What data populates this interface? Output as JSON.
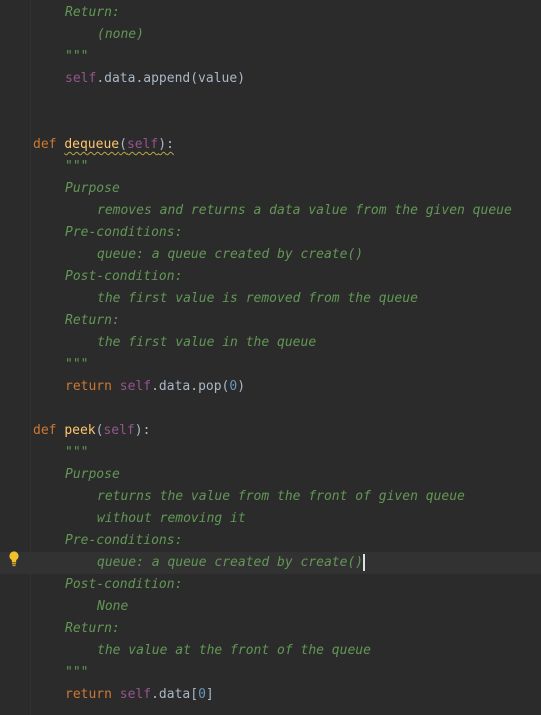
{
  "editor": {
    "lines": [
      {
        "indent": 8,
        "tokens": [
          {
            "t": "doc",
            "v": "Return:"
          }
        ]
      },
      {
        "indent": 12,
        "tokens": [
          {
            "t": "doc",
            "v": "(none)"
          }
        ]
      },
      {
        "indent": 8,
        "tokens": [
          {
            "t": "doc",
            "v": "\"\"\""
          }
        ]
      },
      {
        "indent": 8,
        "tokens": [
          {
            "t": "self",
            "v": "self"
          },
          {
            "t": "plain",
            "v": ".data.append(value)"
          }
        ]
      },
      {
        "indent": 0,
        "tokens": []
      },
      {
        "indent": 0,
        "tokens": []
      },
      {
        "indent": 4,
        "tokens": [
          {
            "t": "kw",
            "v": "def "
          },
          {
            "t": "fn",
            "v": "dequeue",
            "warn": true
          },
          {
            "t": "plain",
            "v": "(",
            "warn": true
          },
          {
            "t": "self",
            "v": "self",
            "warn": true
          },
          {
            "t": "plain",
            "v": "):",
            "warn": true
          }
        ]
      },
      {
        "indent": 8,
        "tokens": [
          {
            "t": "doc",
            "v": "\"\"\""
          }
        ]
      },
      {
        "indent": 8,
        "tokens": [
          {
            "t": "doc",
            "v": "Purpose"
          }
        ]
      },
      {
        "indent": 12,
        "tokens": [
          {
            "t": "doc",
            "v": "removes and returns a data value from the given queue"
          }
        ]
      },
      {
        "indent": 8,
        "tokens": [
          {
            "t": "doc",
            "v": "Pre-conditions:"
          }
        ]
      },
      {
        "indent": 12,
        "tokens": [
          {
            "t": "doc",
            "v": "queue: a queue created by create()"
          }
        ]
      },
      {
        "indent": 8,
        "tokens": [
          {
            "t": "doc",
            "v": "Post-condition:"
          }
        ]
      },
      {
        "indent": 12,
        "tokens": [
          {
            "t": "doc",
            "v": "the first value is removed from the queue"
          }
        ]
      },
      {
        "indent": 8,
        "tokens": [
          {
            "t": "doc",
            "v": "Return:"
          }
        ]
      },
      {
        "indent": 12,
        "tokens": [
          {
            "t": "doc",
            "v": "the first value in the queue"
          }
        ]
      },
      {
        "indent": 8,
        "tokens": [
          {
            "t": "doc",
            "v": "\"\"\""
          }
        ]
      },
      {
        "indent": 8,
        "tokens": [
          {
            "t": "kw",
            "v": "return "
          },
          {
            "t": "self",
            "v": "self"
          },
          {
            "t": "plain",
            "v": ".data.pop("
          },
          {
            "t": "num",
            "v": "0"
          },
          {
            "t": "plain",
            "v": ")"
          }
        ]
      },
      {
        "indent": 0,
        "tokens": []
      },
      {
        "indent": 4,
        "tokens": [
          {
            "t": "kw",
            "v": "def "
          },
          {
            "t": "fn",
            "v": "peek"
          },
          {
            "t": "plain",
            "v": "("
          },
          {
            "t": "self",
            "v": "self"
          },
          {
            "t": "plain",
            "v": "):"
          }
        ]
      },
      {
        "indent": 8,
        "tokens": [
          {
            "t": "doc",
            "v": "\"\"\""
          }
        ]
      },
      {
        "indent": 8,
        "tokens": [
          {
            "t": "doc",
            "v": "Purpose"
          }
        ]
      },
      {
        "indent": 12,
        "tokens": [
          {
            "t": "doc",
            "v": "returns the value from the front of given queue"
          }
        ]
      },
      {
        "indent": 12,
        "tokens": [
          {
            "t": "doc",
            "v": "without removing it"
          }
        ]
      },
      {
        "indent": 8,
        "tokens": [
          {
            "t": "doc",
            "v": "Pre-conditions:"
          }
        ]
      },
      {
        "indent": 12,
        "tokens": [
          {
            "t": "doc",
            "v": "queue: a queue created by create()"
          }
        ],
        "current": true,
        "caret": true
      },
      {
        "indent": 8,
        "tokens": [
          {
            "t": "doc",
            "v": "Post-condition:"
          }
        ]
      },
      {
        "indent": 12,
        "tokens": [
          {
            "t": "doc",
            "v": "None"
          }
        ]
      },
      {
        "indent": 8,
        "tokens": [
          {
            "t": "doc",
            "v": "Return:"
          }
        ]
      },
      {
        "indent": 12,
        "tokens": [
          {
            "t": "doc",
            "v": "the value at the front of the queue"
          }
        ]
      },
      {
        "indent": 8,
        "tokens": [
          {
            "t": "doc",
            "v": "\"\"\""
          }
        ]
      },
      {
        "indent": 8,
        "tokens": [
          {
            "t": "kw",
            "v": "return "
          },
          {
            "t": "self",
            "v": "self"
          },
          {
            "t": "plain",
            "v": ".data["
          },
          {
            "t": "num",
            "v": "0"
          },
          {
            "t": "plain",
            "v": "]"
          }
        ]
      }
    ],
    "intention_icon": "lightbulb-icon",
    "colors": {
      "background": "#2b2b2b",
      "current_line": "#323232",
      "docstring": "#629755",
      "keyword": "#cc7832",
      "self": "#94558d",
      "function": "#ffc66d",
      "number": "#6897bb",
      "text": "#a9b7c6",
      "bulb": "#f0c12c"
    }
  }
}
